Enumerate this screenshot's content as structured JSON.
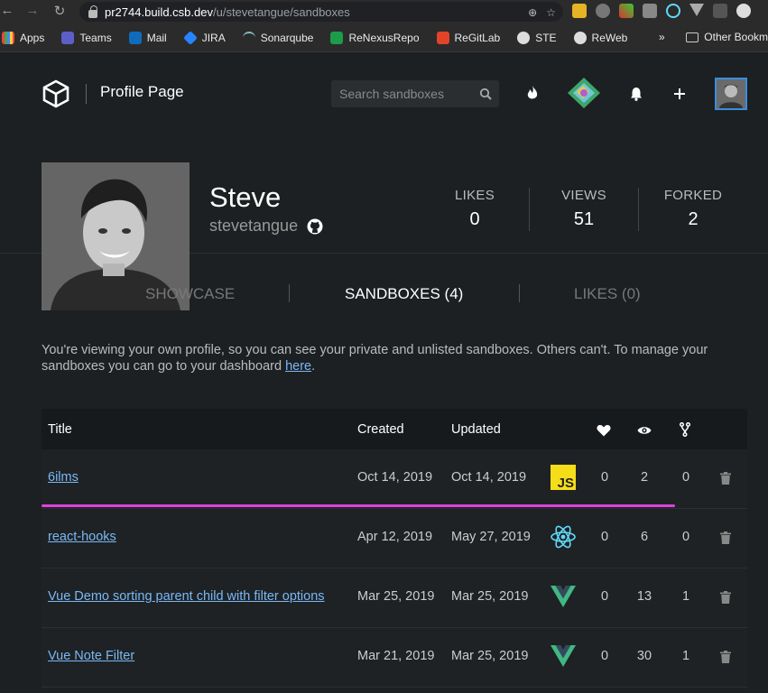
{
  "browser": {
    "url_host": "pr2744.build.csb.dev",
    "url_path": "/u/stevetangue/sandboxes",
    "bookmarks": [
      "Apps",
      "Teams",
      "Mail",
      "JIRA",
      "Sonarqube",
      "ReNexusRepo",
      "ReGitLab",
      "STE",
      "ReWeb"
    ],
    "bookmarks_overflow": "»",
    "other_bookmarks": "Other Bookm"
  },
  "header": {
    "brand": "Profile Page",
    "search_placeholder": "Search sandboxes"
  },
  "profile": {
    "name": "Steve",
    "username": "stevetangue",
    "stats": [
      {
        "label": "LIKES",
        "value": "0"
      },
      {
        "label": "VIEWS",
        "value": "51"
      },
      {
        "label": "FORKED",
        "value": "2"
      }
    ]
  },
  "tabs": [
    {
      "label": "SHOWCASE",
      "active": false
    },
    {
      "label": "SANDBOXES (4)",
      "active": true
    },
    {
      "label": "LIKES (0)",
      "active": false
    }
  ],
  "notice": {
    "text": "You're viewing your own profile, so you can see your private and unlisted sandboxes. Others can't. To manage your sandboxes you can go to your dashboard ",
    "link": "here",
    "suffix": "."
  },
  "table": {
    "headers": {
      "title": "Title",
      "created": "Created",
      "updated": "Updated"
    },
    "rows": [
      {
        "title": "6ilms",
        "created": "Oct 14, 2019",
        "updated": "Oct 14, 2019",
        "template": "js-icon",
        "likes": "0",
        "views": "2",
        "forks": "0"
      },
      {
        "title": "react-hooks",
        "created": "Apr 12, 2019",
        "updated": "May 27, 2019",
        "template": "react-icon",
        "likes": "0",
        "views": "6",
        "forks": "0"
      },
      {
        "title": "Vue Demo sorting parent child with filter options",
        "created": "Mar 25, 2019",
        "updated": "Mar 25, 2019",
        "template": "vue-icon",
        "likes": "0",
        "views": "13",
        "forks": "1"
      },
      {
        "title": "Vue Note Filter",
        "created": "Mar 21, 2019",
        "updated": "Mar 25, 2019",
        "template": "vue-icon",
        "likes": "0",
        "views": "30",
        "forks": "1"
      }
    ]
  },
  "colors": {
    "accent": "#7ab8f5",
    "highlight_line": "#e040e0",
    "js_badge": "#f5de19",
    "vue": "#41b883",
    "react": "#61dafb"
  }
}
